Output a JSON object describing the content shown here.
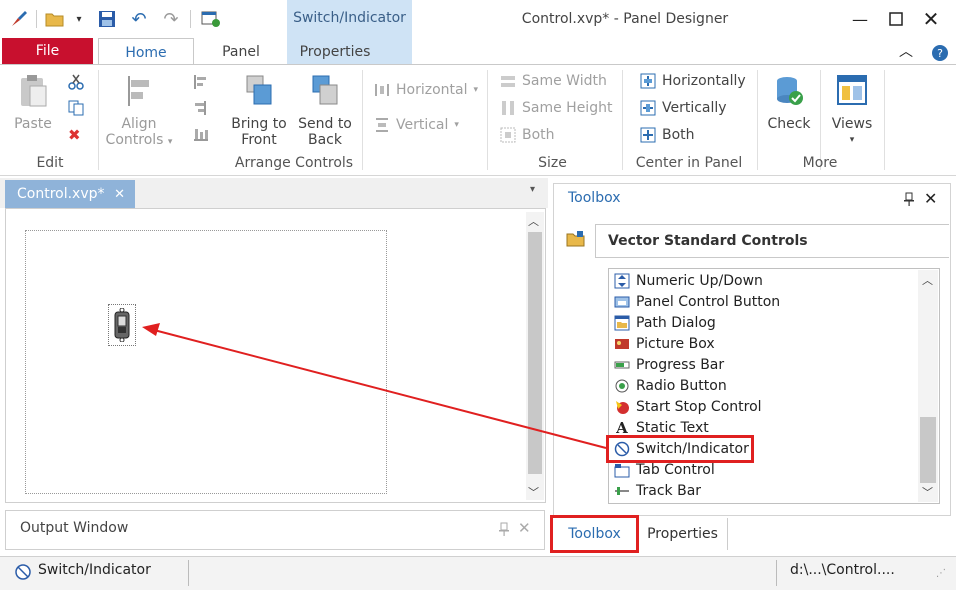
{
  "window": {
    "title": "Control.xvp* - Panel Designer",
    "contextual_tab_group": "Switch/Indicator"
  },
  "tabs": {
    "file": "File",
    "home": "Home",
    "panel": "Panel",
    "properties": "Properties"
  },
  "ribbon": {
    "edit": {
      "group_label": "Edit",
      "paste": "Paste"
    },
    "arrange": {
      "group_label": "Arrange Controls",
      "align_controls_line1": "Align",
      "align_controls_line2": "Controls",
      "bring_to_front_line1": "Bring to",
      "bring_to_front_line2": "Front",
      "send_to_back_line1": "Send to",
      "send_to_back_line2": "Back",
      "horizontal": "Horizontal",
      "vertical": "Vertical"
    },
    "size": {
      "group_label": "Size",
      "same_width": "Same Width",
      "same_height": "Same Height",
      "both": "Both"
    },
    "center": {
      "group_label": "Center in Panel",
      "horizontally": "Horizontally",
      "vertically": "Vertically",
      "both": "Both"
    },
    "more": {
      "group_label": "More",
      "check": "Check",
      "views": "Views"
    }
  },
  "document": {
    "tab_label": "Control.xvp*"
  },
  "toolbox": {
    "title": "Toolbox",
    "group": "Vector Standard Controls",
    "items": [
      {
        "label": "Numeric Up/Down",
        "icon": "numeric-updown-icon"
      },
      {
        "label": "Panel Control Button",
        "icon": "panel-control-button-icon"
      },
      {
        "label": "Path Dialog",
        "icon": "path-dialog-icon"
      },
      {
        "label": "Picture Box",
        "icon": "picture-box-icon"
      },
      {
        "label": "Progress Bar",
        "icon": "progress-bar-icon"
      },
      {
        "label": "Radio Button",
        "icon": "radio-button-icon"
      },
      {
        "label": "Start Stop Control",
        "icon": "start-stop-icon"
      },
      {
        "label": "Static Text",
        "icon": "static-text-icon"
      },
      {
        "label": "Switch/Indicator",
        "icon": "switch-indicator-icon"
      },
      {
        "label": "Tab Control",
        "icon": "tab-control-icon"
      },
      {
        "label": "Track Bar",
        "icon": "track-bar-icon"
      }
    ]
  },
  "output_window": {
    "title": "Output Window"
  },
  "bottom_tabs": {
    "toolbox": "Toolbox",
    "properties": "Properties"
  },
  "status": {
    "selected": "Switch/Indicator",
    "path": "d:\\...\\Control...."
  },
  "colors": {
    "file_tab": "#c8102e",
    "accent_blue": "#2b6cb0",
    "contextual_header": "#cfe3f5",
    "highlight_red": "#e02020"
  }
}
